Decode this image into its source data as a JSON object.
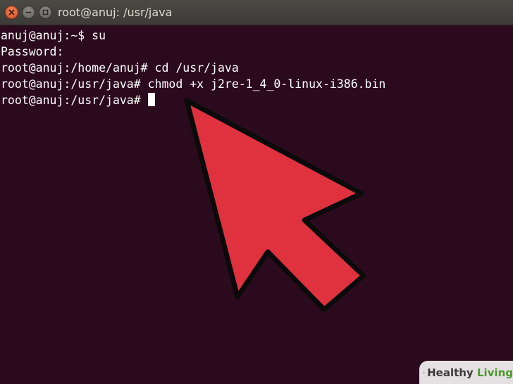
{
  "window": {
    "title": "root@anuj: /usr/java",
    "buttons": [
      "close",
      "minimize",
      "maximize"
    ]
  },
  "terminal": {
    "lines": [
      "anuj@anuj:~$ su",
      "Password:",
      "root@anuj:/home/anuj# cd /usr/java",
      "root@anuj:/usr/java# chmod +x j2re-1_4_0-linux-i386.bin",
      "root@anuj:/usr/java#"
    ],
    "colors": {
      "background": "#2c0a1e",
      "text": "#ffffff"
    }
  },
  "overlay": {
    "arrow_icon": "pointer-arrow-icon",
    "arrow_color": "#e0313f"
  },
  "watermark": {
    "brand_first": "Healthy",
    "brand_second": "Living"
  }
}
